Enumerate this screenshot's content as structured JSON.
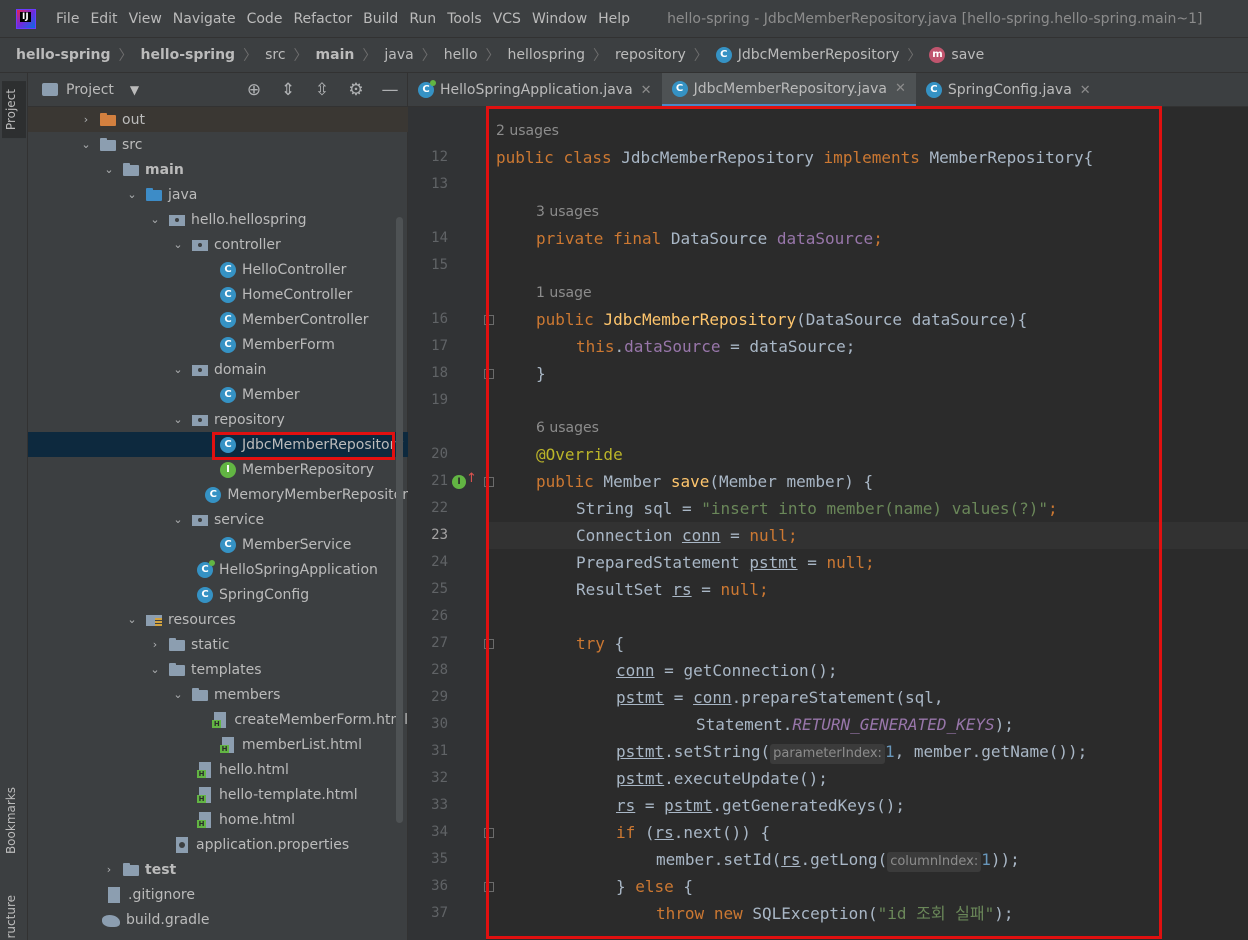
{
  "menubar": {
    "items": [
      "File",
      "Edit",
      "View",
      "Navigate",
      "Code",
      "Refactor",
      "Build",
      "Run",
      "Tools",
      "VCS",
      "Window",
      "Help"
    ],
    "window_title": "hello-spring - JdbcMemberRepository.java [hello-spring.hello-spring.main~1]"
  },
  "breadcrumb": {
    "items": [
      "hello-spring",
      "hello-spring",
      "src",
      "main",
      "java",
      "hello",
      "hellospring",
      "repository",
      "JdbcMemberRepository",
      "save"
    ]
  },
  "toolstrip": {
    "project": "Project",
    "bookmarks": "Bookmarks",
    "structure": "ructure"
  },
  "project_panel": {
    "title": "Project",
    "tree": [
      {
        "label": "out"
      },
      {
        "label": "src"
      },
      {
        "label": "main"
      },
      {
        "label": "java"
      },
      {
        "label": "hello.hellospring"
      },
      {
        "label": "controller"
      },
      {
        "label": "HelloController"
      },
      {
        "label": "HomeController"
      },
      {
        "label": "MemberController"
      },
      {
        "label": "MemberForm"
      },
      {
        "label": "domain"
      },
      {
        "label": "Member"
      },
      {
        "label": "repository"
      },
      {
        "label": "JdbcMemberRepository"
      },
      {
        "label": "MemberRepository"
      },
      {
        "label": "MemoryMemberRepositor"
      },
      {
        "label": "service"
      },
      {
        "label": "MemberService"
      },
      {
        "label": "HelloSpringApplication"
      },
      {
        "label": "SpringConfig"
      },
      {
        "label": "resources"
      },
      {
        "label": "static"
      },
      {
        "label": "templates"
      },
      {
        "label": "members"
      },
      {
        "label": "createMemberForm.html"
      },
      {
        "label": "memberList.html"
      },
      {
        "label": "hello.html"
      },
      {
        "label": "hello-template.html"
      },
      {
        "label": "home.html"
      },
      {
        "label": "application.properties"
      },
      {
        "label": "test"
      },
      {
        "label": ".gitignore"
      },
      {
        "label": "build.gradle"
      }
    ]
  },
  "tabs": [
    {
      "label": "HelloSpringApplication.java"
    },
    {
      "label": "JdbcMemberRepository.java"
    },
    {
      "label": "SpringConfig.java"
    }
  ],
  "editor": {
    "line_numbers": [
      "12",
      "13",
      "14",
      "15",
      "16",
      "17",
      "18",
      "19",
      "20",
      "21",
      "22",
      "23",
      "24",
      "25",
      "26",
      "27",
      "28",
      "29",
      "30",
      "31",
      "32",
      "33",
      "34",
      "35",
      "36",
      "37"
    ],
    "usages": [
      "2 usages",
      "3 usages",
      "1 usage",
      "6 usages"
    ],
    "hints": [
      "parameterIndex:",
      "columnIndex:"
    ],
    "tokens": {
      "public": "public",
      "class": "class",
      "class_name": "JdbcMemberRepository",
      "implements": "implements",
      "iface": "MemberRepository{",
      "private": "private",
      "final": "final",
      "DataSource": "DataSource",
      "dataSource": "dataSource",
      "semicolon": ";",
      "ctor_params": "(DataSource dataSource){",
      "this": "this",
      "assign_ds": " = dataSource;",
      "close_brace": "}",
      "override": "@Override",
      "member_type": " Member ",
      "save": "save",
      "save_params": "(Member member) {",
      "string_decl": "String sql = ",
      "sql_str": "\"insert into member(name) values(?)\"",
      "conn_decl": "Connection ",
      "conn": "conn",
      "eq": " = ",
      "null": "null",
      "pstmt_decl": "PreparedStatement ",
      "pstmt": "pstmt",
      "rs_decl": "ResultSet ",
      "rs": "rs",
      "try": "try",
      "open_brace": " {",
      "get_conn": "getConnection();",
      "prep_stmt": ".prepareStatement(sql,",
      "statement": "Statement.",
      "rgk": "RETURN_GENERATED_KEYS",
      "close_paren_semi": ");",
      "set_string": ".setString(",
      "one": "1",
      "get_name": ", member.getName());",
      "exec_update": ".executeUpdate();",
      "gen_keys": ".getGeneratedKeys();",
      "if": "if",
      "paren_open": " (",
      "next": ".next()) {",
      "set_id": "member.setId(",
      "get_long": ".getLong(",
      "close_two": "));",
      "else_pre": "} ",
      "else": "else",
      "throw": "throw",
      "new": "new",
      "sql_exc": " SQLException(",
      "exc_msg": "\"id 조회 실패\"",
      "exc_tail": ");"
    }
  }
}
